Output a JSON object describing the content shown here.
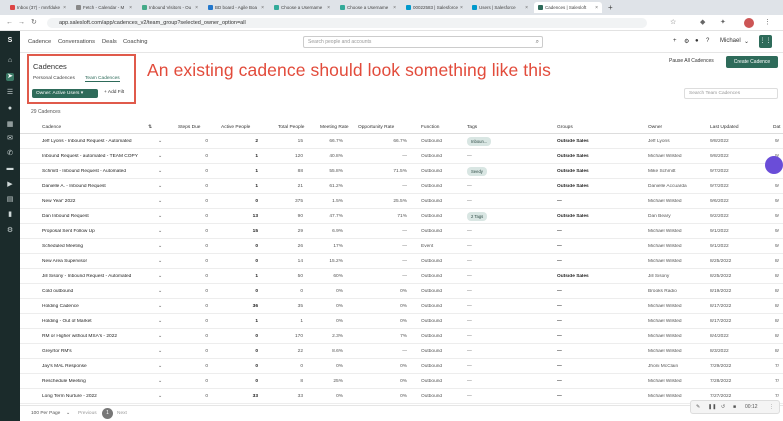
{
  "browser": {
    "tabs": [
      {
        "label": "Inbox (37) - mnrfduke"
      },
      {
        "label": "Fetch - Calendar - M"
      },
      {
        "label": "Inbound Visitors - Ou"
      },
      {
        "label": "BD board - Agile Boa"
      },
      {
        "label": "Choose a Username"
      },
      {
        "label": "Choose a Username"
      },
      {
        "label": "00022583 | Salesforce"
      },
      {
        "label": "Users | Salesforce"
      },
      {
        "label": "Cadences | Salesloft"
      }
    ],
    "url": "app.salesloft.com/app/cadences_v2/team_group?selected_owner_option=all"
  },
  "topnav": {
    "links": [
      "Cadence",
      "Conversations",
      "Deals",
      "Coaching"
    ],
    "search_placeholder": "Search people and accounts",
    "user": "Michael"
  },
  "overlay": {
    "text": "An existing cadence should look something like this"
  },
  "page": {
    "title": "Cadences",
    "tabs": [
      "Personal Cadences",
      "Team Cadences"
    ],
    "owner_filter": "Owner: Active Users",
    "add_filter": "+ Add Filt",
    "pause_all": "Pause All Cadences",
    "create": "Create Cadence",
    "search_team": "Search Team Cadences",
    "count": "29 Cadences"
  },
  "table": {
    "headers": [
      "Cadence",
      "Steps Due",
      "Active People",
      "Total People",
      "Meeting Rate",
      "Opportunity Rate",
      "Function",
      "Tags",
      "Groups",
      "Owner",
      "Last Updated",
      "Dat"
    ],
    "rows": [
      {
        "name": "Jeff Lyons - Inbound Request - Automated",
        "steps": "0",
        "active": "2",
        "total": "15",
        "meeting": "66.7%",
        "opp": "66.7%",
        "function": "Outbound",
        "tags": "Inboun...",
        "groups": "Outside Sales",
        "owner": "Jeff Lyons",
        "updated": "9/8/2022",
        "dat": "9/"
      },
      {
        "name": "Inbound Request - automated - TEAM COPY",
        "steps": "0",
        "active": "1",
        "total": "120",
        "meeting": "40.8%",
        "opp": "—",
        "function": "Outbound",
        "tags": "—",
        "groups": "Outside Sales",
        "owner": "Michael Wilsted",
        "updated": "9/8/2022",
        "dat": "9/"
      },
      {
        "name": "Schmitt - Inbound Request - Automated",
        "steps": "0",
        "active": "1",
        "total": "88",
        "meeting": "55.8%",
        "opp": "71.5%",
        "function": "Outbound",
        "tags": "Seedy",
        "groups": "Outside Sales",
        "owner": "Mike Schmitt",
        "updated": "9/7/2022",
        "dat": "9/"
      },
      {
        "name": "Danielle A. - Inbound Request",
        "steps": "0",
        "active": "1",
        "total": "21",
        "meeting": "61.2%",
        "opp": "—",
        "function": "Outbound",
        "tags": "—",
        "groups": "Outside Sales",
        "owner": "Danielle Accuarda",
        "updated": "9/7/2022",
        "dat": "9/"
      },
      {
        "name": "New Year' 2022",
        "steps": "0",
        "active": "0",
        "total": "375",
        "meeting": "1.5%",
        "opp": "25.5%",
        "function": "Outbound",
        "tags": "—",
        "groups": "—",
        "owner": "Michael Wilsted",
        "updated": "9/6/2022",
        "dat": "9/"
      },
      {
        "name": "Dan Inbound Request",
        "steps": "0",
        "active": "13",
        "total": "90",
        "meeting": "47.7%",
        "opp": "71%",
        "function": "Outbound",
        "tags": "2 Tags",
        "groups": "Outside Sales",
        "owner": "Dan Beary",
        "updated": "9/2/2022",
        "dat": "9/"
      },
      {
        "name": "Proposal Sent Follow Up",
        "steps": "0",
        "active": "15",
        "total": "29",
        "meeting": "6.9%",
        "opp": "—",
        "function": "Outbound",
        "tags": "—",
        "groups": "—",
        "owner": "Michael Wilsted",
        "updated": "9/1/2022",
        "dat": "9/"
      },
      {
        "name": "Scheduled Meeting",
        "steps": "0",
        "active": "0",
        "total": "26",
        "meeting": "17%",
        "opp": "—",
        "function": "Event",
        "tags": "—",
        "groups": "—",
        "owner": "Michael Wilsted",
        "updated": "9/1/2022",
        "dat": "9/"
      },
      {
        "name": "New Area Supervisor",
        "steps": "0",
        "active": "0",
        "total": "14",
        "meeting": "15.2%",
        "opp": "—",
        "function": "Outbound",
        "tags": "—",
        "groups": "—",
        "owner": "Michael Wilsted",
        "updated": "8/25/2022",
        "dat": "8/"
      },
      {
        "name": "Jill Sisony - Inbound Request - Automated",
        "steps": "0",
        "active": "1",
        "total": "50",
        "meeting": "60%",
        "opp": "—",
        "function": "Outbound",
        "tags": "—",
        "groups": "Outside Sales",
        "owner": "Jill Sisony",
        "updated": "8/25/2022",
        "dat": "8/"
      },
      {
        "name": "Cold outbound",
        "steps": "0",
        "active": "0",
        "total": "0",
        "meeting": "0%",
        "opp": "0%",
        "function": "Outbound",
        "tags": "—",
        "groups": "—",
        "owner": "Brooks Radio",
        "updated": "8/19/2022",
        "dat": "8/"
      },
      {
        "name": "Holding Cadence",
        "steps": "0",
        "active": "36",
        "total": "35",
        "meeting": "0%",
        "opp": "0%",
        "function": "Outbound",
        "tags": "—",
        "groups": "—",
        "owner": "Michael Wilsted",
        "updated": "8/17/2022",
        "dat": "8/"
      },
      {
        "name": "Holding - Out of Market",
        "steps": "0",
        "active": "1",
        "total": "1",
        "meeting": "0%",
        "opp": "0%",
        "function": "Outbound",
        "tags": "—",
        "groups": "—",
        "owner": "Michael Wilsted",
        "updated": "8/17/2022",
        "dat": "8/"
      },
      {
        "name": "RM or Higher without MSA's - 2022",
        "steps": "0",
        "active": "0",
        "total": "170",
        "meeting": "2.3%",
        "opp": "7%",
        "function": "Outbound",
        "tags": "—",
        "groups": "—",
        "owner": "Michael Wilsted",
        "updated": "8/4/2022",
        "dat": "8/"
      },
      {
        "name": "Greyrtor RM's",
        "steps": "0",
        "active": "0",
        "total": "22",
        "meeting": "8.6%",
        "opp": "—",
        "function": "Outbound",
        "tags": "—",
        "groups": "—",
        "owner": "Michael Wilsted",
        "updated": "8/3/2022",
        "dat": "8/"
      },
      {
        "name": "Jay's MAL Response",
        "steps": "0",
        "active": "0",
        "total": "0",
        "meeting": "0%",
        "opp": "0%",
        "function": "Outbound",
        "tags": "—",
        "groups": "—",
        "owner": "Jhoni McClain",
        "updated": "7/29/2022",
        "dat": "7/"
      },
      {
        "name": "Reschedule Meeting",
        "steps": "0",
        "active": "0",
        "total": "8",
        "meeting": "25%",
        "opp": "0%",
        "function": "Outbound",
        "tags": "—",
        "groups": "—",
        "owner": "Michael Wilsted",
        "updated": "7/28/2022",
        "dat": "7/"
      },
      {
        "name": "Long Term Nurture - 2022",
        "steps": "0",
        "active": "33",
        "total": "33",
        "meeting": "0%",
        "opp": "0%",
        "function": "Outbound",
        "tags": "—",
        "groups": "—",
        "owner": "Michael Wilsted",
        "updated": "7/27/2022",
        "dat": "7/"
      }
    ]
  },
  "footer": {
    "per_page": "100 Per Page",
    "previous": "Previous",
    "page": "1",
    "next": "Next",
    "time": "00:12"
  },
  "colors": {
    "brand": "#2e6b5a",
    "annotation": "#e24b3b",
    "sidebar": "#1b2b2b"
  }
}
